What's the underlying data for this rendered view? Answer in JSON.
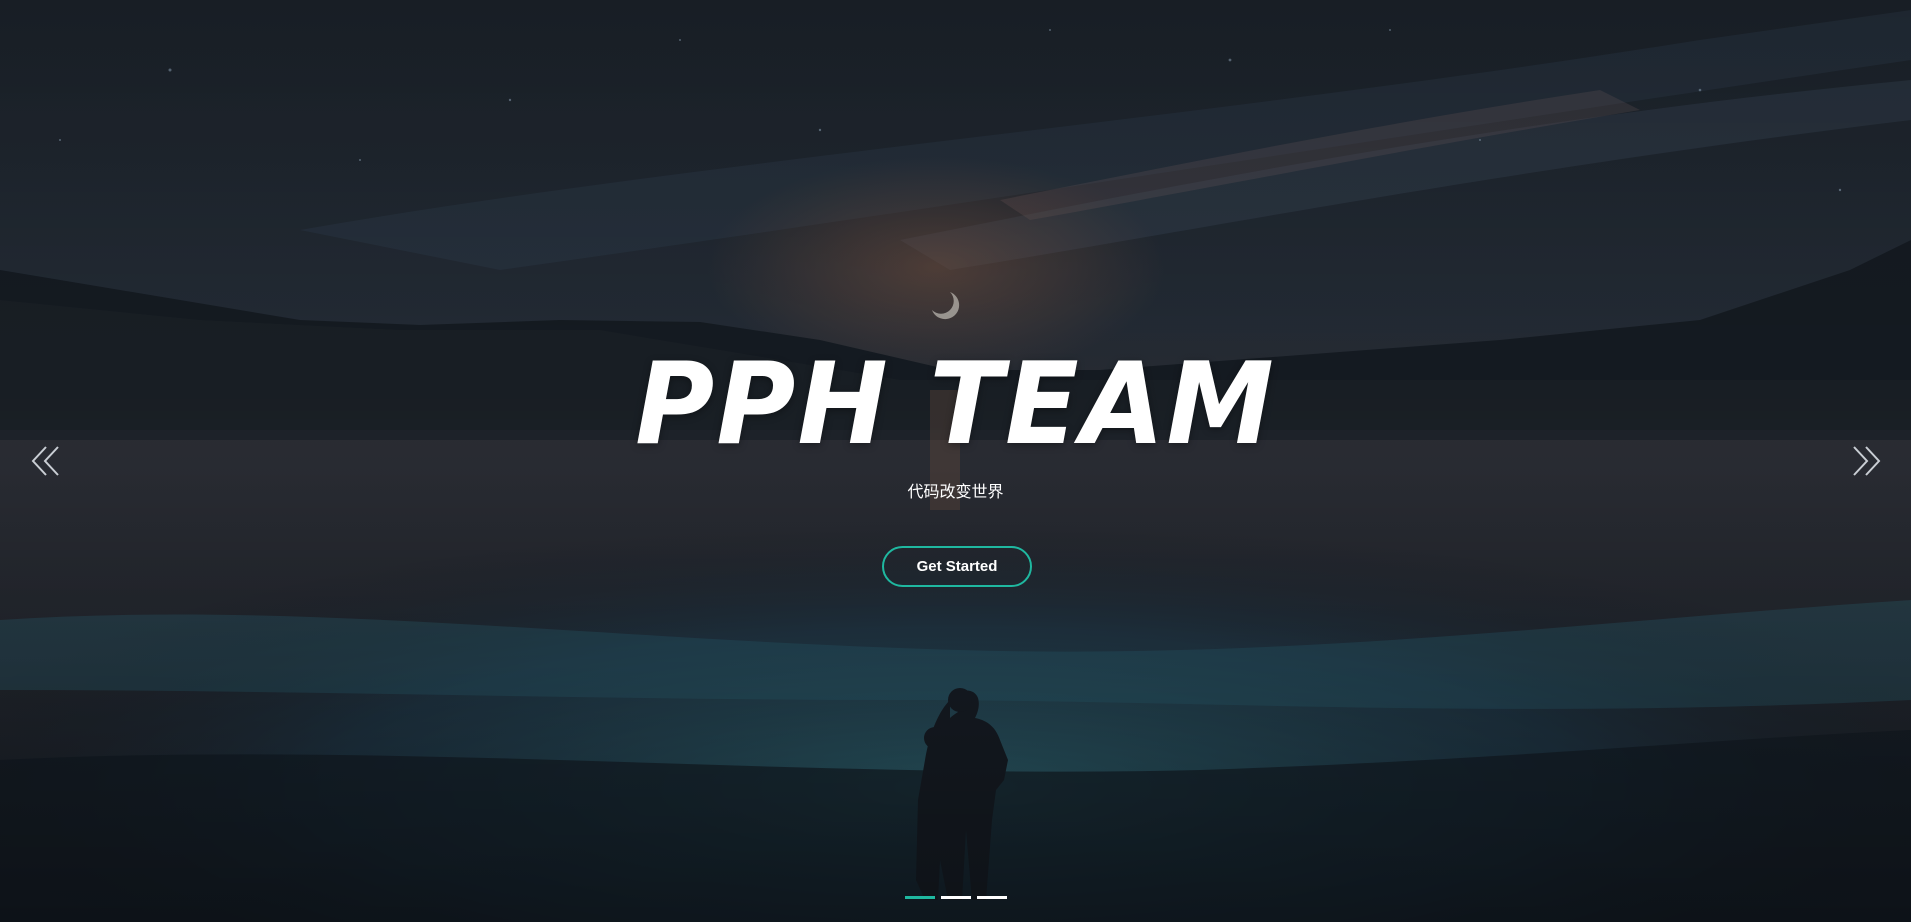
{
  "hero": {
    "title": "PPH TEAM",
    "subtitle": "代码改变世界",
    "cta_label": "Get Started"
  },
  "carousel": {
    "prev_icon": "chevron-double-left-icon",
    "next_icon": "chevron-double-right-icon",
    "slide_count": 3,
    "active_index": 0
  },
  "colors": {
    "accent": "#1fb8a0",
    "background": "#151a20",
    "text": "#ffffff"
  }
}
